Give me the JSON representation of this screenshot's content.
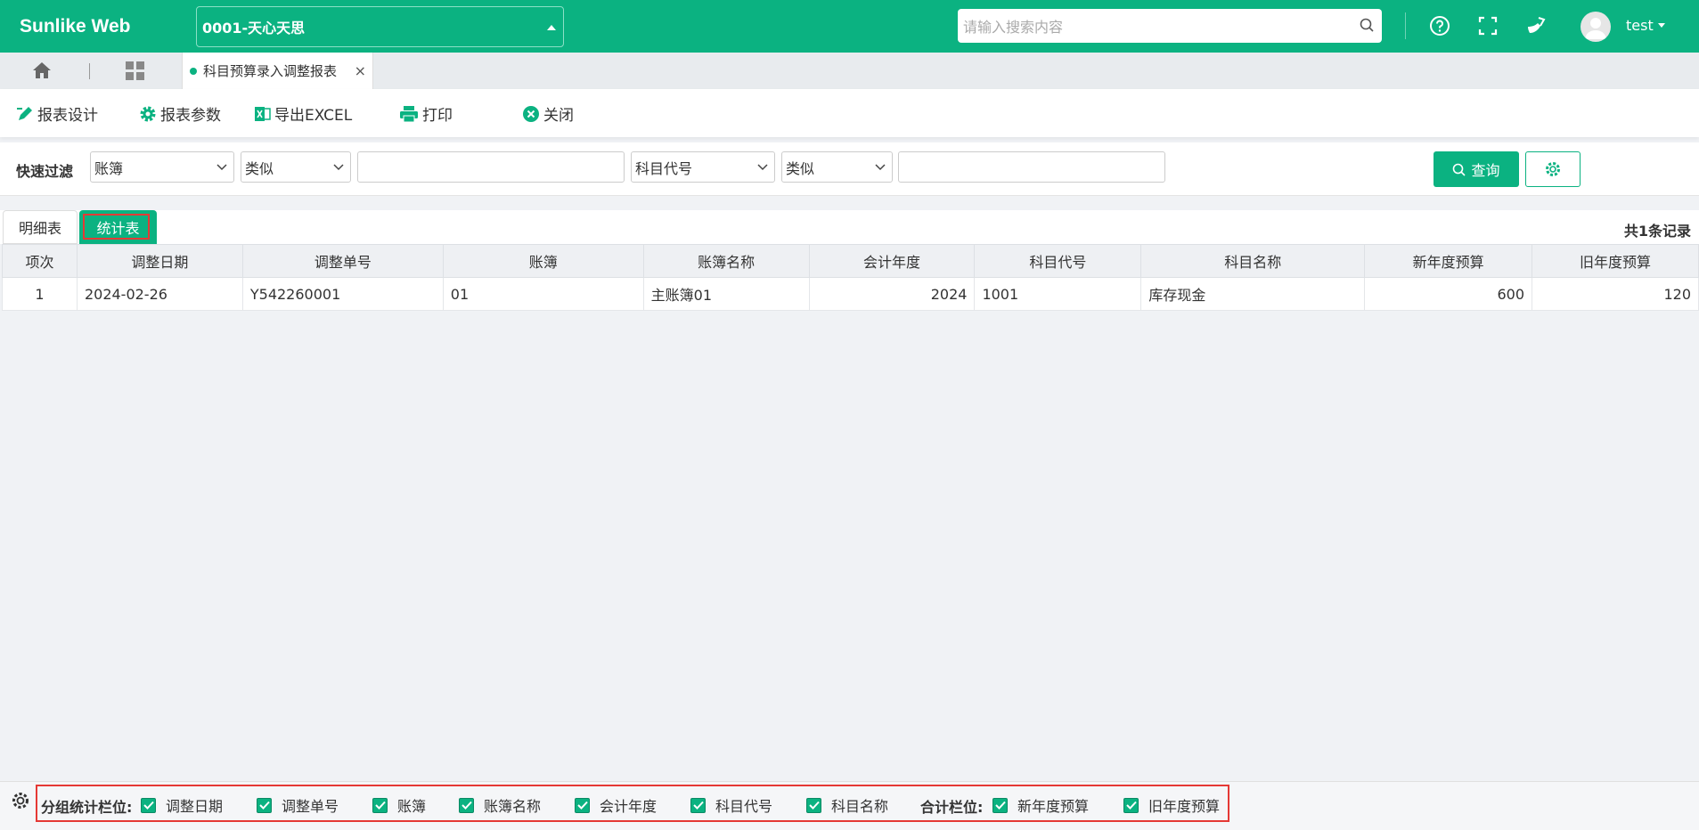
{
  "app": {
    "logo": "Sunlike Web",
    "org": "0001-天心天思",
    "search_placeholder": "请输入搜索内容",
    "user": "test"
  },
  "tabs": {
    "active_label": "科目预算录入调整报表",
    "close_glyph": "×"
  },
  "toolbar": {
    "design": "报表设计",
    "params": "报表参数",
    "export": "导出EXCEL",
    "print": "打印",
    "close": "关闭"
  },
  "filter": {
    "label": "快速过滤",
    "field1": "账簿",
    "op1": "类似",
    "value1": "",
    "field2": "科目代号",
    "op2": "类似",
    "value2": "",
    "query": "查询"
  },
  "subtabs": {
    "detail": "明细表",
    "stats": "统计表",
    "record_count": "共1条记录"
  },
  "table": {
    "headers": [
      "项次",
      "调整日期",
      "调整单号",
      "账簿",
      "账簿名称",
      "会计年度",
      "科目代号",
      "科目名称",
      "新年度预算",
      "旧年度预算"
    ],
    "rows": [
      [
        "1",
        "2024-02-26",
        "Y542260001",
        "01",
        "主账簿01",
        "2024",
        "1001",
        "库存现金",
        "600",
        "120"
      ]
    ]
  },
  "bottom": {
    "group_label": "分组统计栏位:",
    "group_fields": [
      "调整日期",
      "调整单号",
      "账簿",
      "账簿名称",
      "会计年度",
      "科目代号",
      "科目名称"
    ],
    "sum_label": "合计栏位:",
    "sum_fields": [
      "新年度预算",
      "旧年度预算"
    ]
  },
  "colors": {
    "brand": "#0bb281",
    "highlight": "#e53935"
  }
}
